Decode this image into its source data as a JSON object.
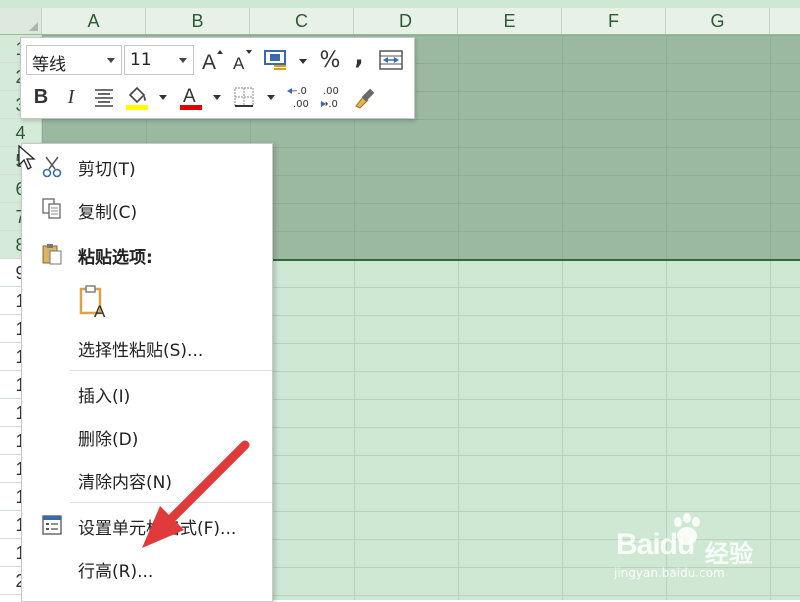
{
  "spreadsheet": {
    "columns": [
      "A",
      "B",
      "C",
      "D",
      "E",
      "F",
      "G"
    ],
    "rows": [
      "1",
      "2",
      "3",
      "4",
      "5",
      "6",
      "7",
      "8",
      "9",
      "1",
      "1",
      "1",
      "1",
      "1",
      "1",
      "1",
      "1",
      "1",
      "1",
      "2"
    ]
  },
  "mini_toolbar": {
    "font_name": "等线",
    "font_size": "11",
    "percent_label": "%",
    "comma_label": ",",
    "bold_label": "B",
    "italic_label": "I",
    "highlight_color": "#ffff00",
    "font_color": "#e00000"
  },
  "context_menu": {
    "cut": "剪切(T)",
    "copy": "复制(C)",
    "paste_options": "粘贴选项:",
    "paste_special": "选择性粘贴(S)...",
    "insert": "插入(I)",
    "delete": "删除(D)",
    "clear_contents": "清除内容(N)",
    "format_cells": "设置单元格格式(F)...",
    "row_height": "行高(R)..."
  },
  "watermark": {
    "brand": "Baidu",
    "brand_cn": "经验",
    "url": "jingyan.baidu.com"
  },
  "colors": {
    "accent_red": "#e03a3a",
    "selection_green": "#9bb9a1",
    "sheet_green": "#cfe8d3"
  }
}
